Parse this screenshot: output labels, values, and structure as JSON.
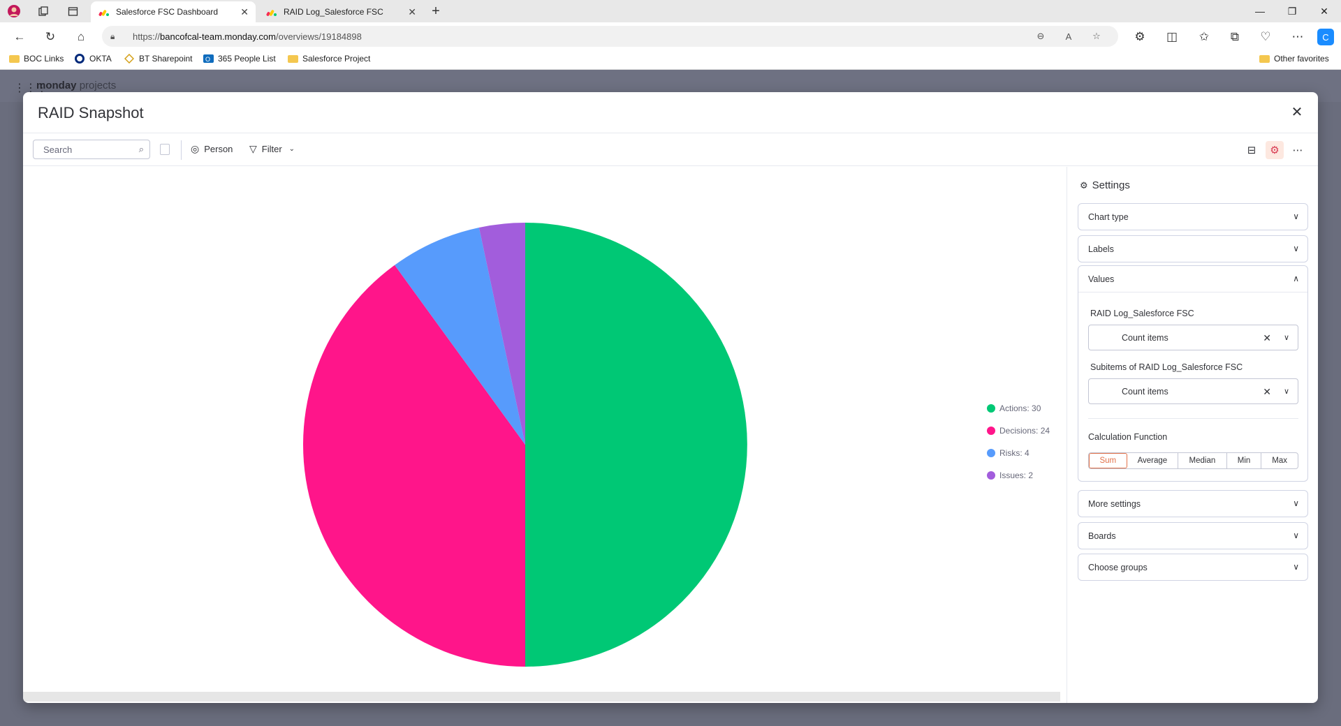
{
  "browser": {
    "tabs": [
      {
        "title": "Salesforce FSC Dashboard",
        "active": true
      },
      {
        "title": "RAID Log_Salesforce FSC",
        "active": false
      }
    ],
    "url_prefix": "https://",
    "url_domain": "bancofcal-team.monday.com",
    "url_path": "/overviews/19184898",
    "bookmarks": [
      "BOC Links",
      "OKTA",
      "BT Sharepoint",
      "365 People List",
      "Salesforce Project"
    ],
    "other_favorites": "Other favorites"
  },
  "app": {
    "brand": "monday",
    "brand_suffix": "projects"
  },
  "modal": {
    "title": "RAID Snapshot",
    "close_icon": "×",
    "toolbar": {
      "search_placeholder": "Search",
      "person_label": "Person",
      "filter_label": "Filter"
    }
  },
  "chart_data": {
    "type": "pie",
    "categories": [
      "Actions",
      "Decisions",
      "Risks",
      "Issues"
    ],
    "values": [
      30,
      24,
      4,
      2
    ],
    "colors": [
      "#00c875",
      "#ff158a",
      "#579bfc",
      "#a25ddc"
    ],
    "legend": [
      "Actions: 30",
      "Decisions: 24",
      "Risks: 4",
      "Issues: 2"
    ],
    "legend_position": "right"
  },
  "settings": {
    "title": "Settings",
    "chart_type": "Chart type",
    "labels": "Labels",
    "values": "Values",
    "board1_label": "RAID Log_Salesforce FSC",
    "board1_value": "Count items",
    "board2_label": "Subitems of RAID Log_Salesforce FSC",
    "board2_value": "Count items",
    "calc_label": "Calculation Function",
    "calc_options": [
      "Sum",
      "Average",
      "Median",
      "Min",
      "Max"
    ],
    "calc_selected": "Sum",
    "more_settings": "More settings",
    "boards": "Boards",
    "choose_groups": "Choose groups"
  }
}
